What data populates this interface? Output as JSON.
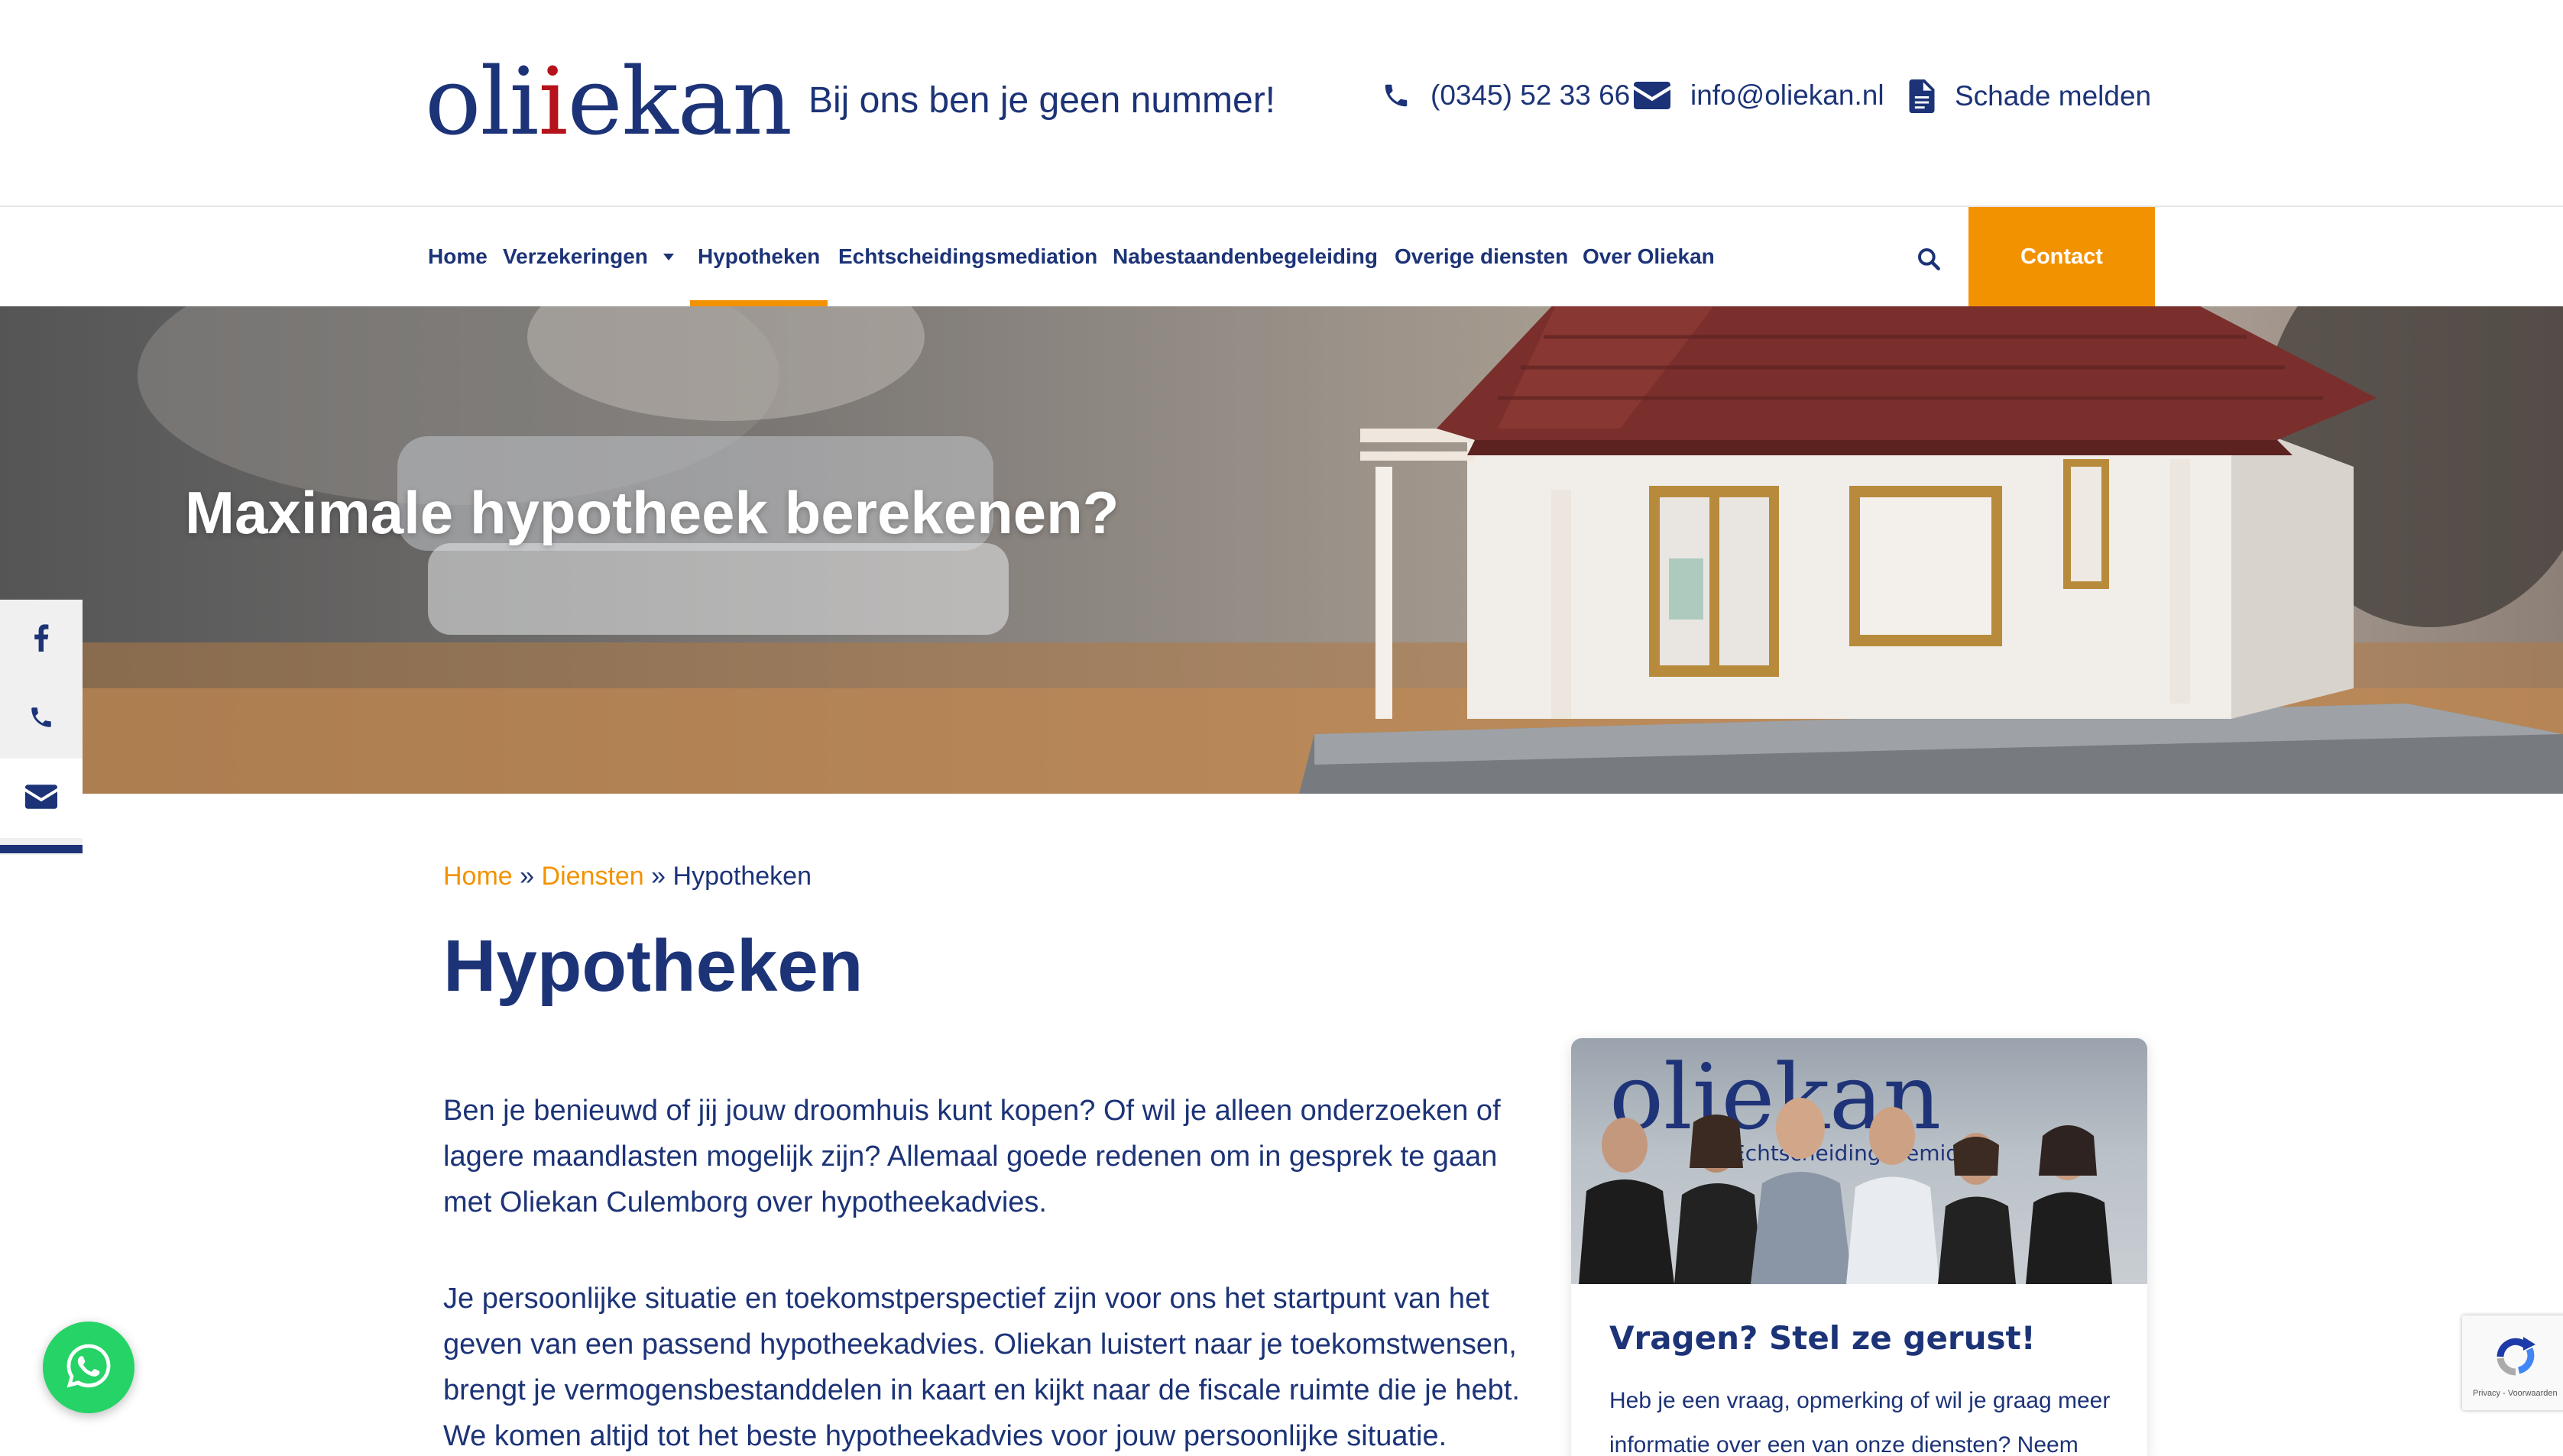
{
  "brand": {
    "logo_text_1": "oli",
    "logo_text_2": "i",
    "logo_text_3": "ekan",
    "tagline": "Bij ons ben je geen nummer!"
  },
  "header": {
    "phone": "(0345) 52 33 66",
    "email": "info@oliekan.nl",
    "damage": "Schade melden"
  },
  "nav": {
    "items": [
      {
        "label": "Home"
      },
      {
        "label": "Verzekeringen"
      },
      {
        "label": "Hypotheken"
      },
      {
        "label": "Echtscheidingsmediation"
      },
      {
        "label": "Nabestaandenbegeleiding"
      },
      {
        "label": "Overige diensten"
      },
      {
        "label": "Over Oliekan"
      }
    ],
    "active": "Hypotheken",
    "contact_label": "Contact"
  },
  "hero": {
    "title": "Maximale hypotheek berekenen?"
  },
  "breadcrumb": {
    "home": "Home",
    "sep": " » ",
    "diensten": "Diensten",
    "current": "Hypotheken"
  },
  "main": {
    "title": "Hypotheken",
    "paragraph_1": "Ben je benieuwd of jij jouw droomhuis kunt kopen? Of wil je alleen onderzoeken of lagere maandlasten mogelijk zijn? Allemaal goede redenen om in gesprek te gaan met Oliekan Culemborg over hypotheekadvies.",
    "paragraph_2": "Je persoonlijke situatie en toekomstperspectief zijn voor ons het startpunt van het geven van een passend hypotheekadvies. Oliekan luistert naar je toekomstwensen, brengt je vermogensbestanddelen in kaart en kijkt naar de fiscale ruimte die je hebt. We komen altijd tot het beste hypotheekadvies voor jouw persoonlijke situatie."
  },
  "card": {
    "photo_sign_1": "oliekan",
    "photo_sign_2": "Echtscheidingsbemidd",
    "title": "Vragen? Stel ze gerust!",
    "text": "Heb je een vraag, opmerking of wil je graag meer informatie over een van onze diensten? Neem"
  },
  "recaptcha": {
    "label": "Privacy - Voorwaarden"
  },
  "colors": {
    "navy": "#1c3377",
    "orange": "#f39200",
    "logo_red": "#b5121b",
    "whatsapp": "#25d366"
  },
  "icons": [
    "phone-icon",
    "envelope-icon",
    "document-icon",
    "search-icon",
    "facebook-icon",
    "whatsapp-icon",
    "recaptcha-icon"
  ]
}
